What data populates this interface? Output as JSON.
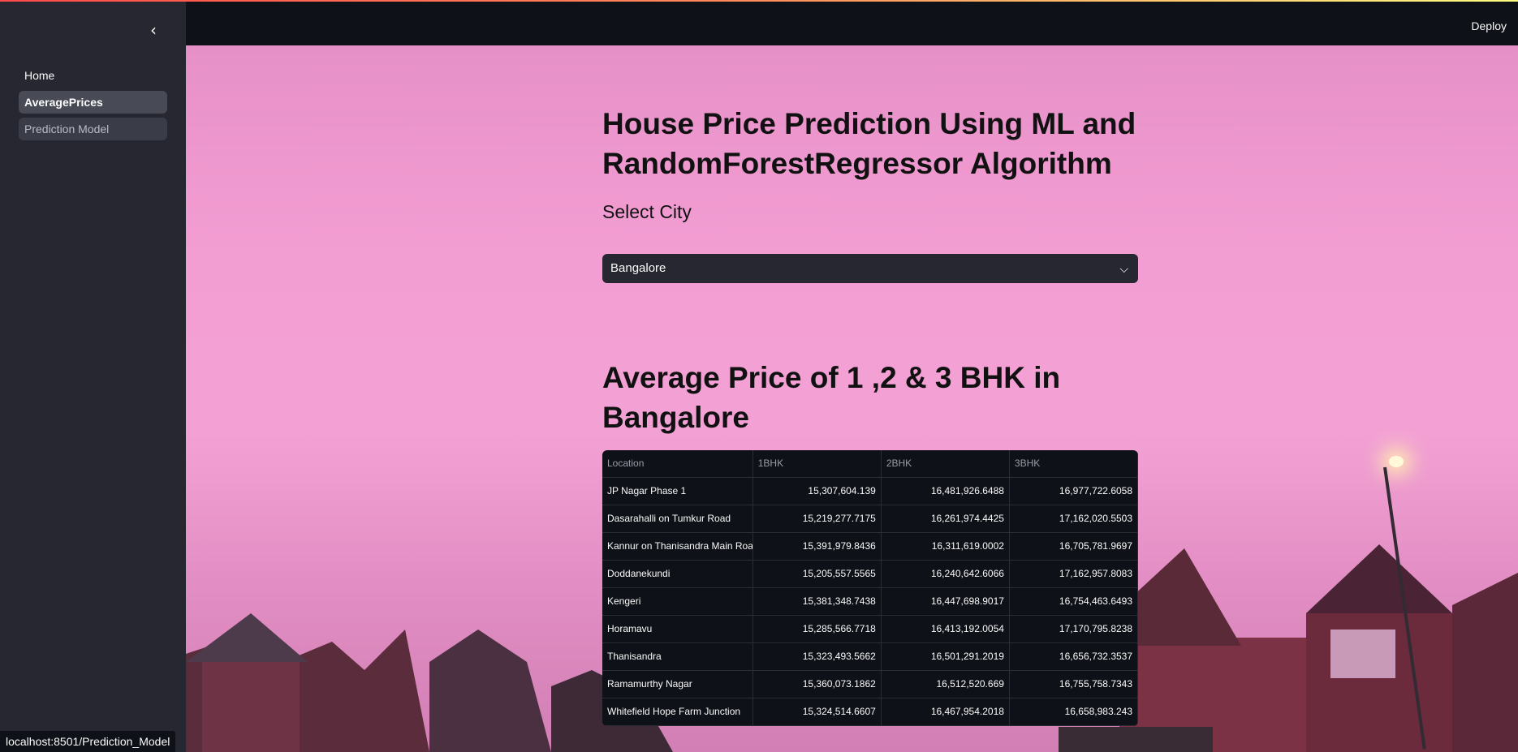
{
  "sidebar": {
    "collapse_icon": "chevron-left-icon",
    "items": [
      {
        "label": "Home",
        "state": "normal"
      },
      {
        "label": "AveragePrices",
        "state": "active"
      },
      {
        "label": "Prediction Model",
        "state": "hover"
      }
    ]
  },
  "header": {
    "deploy_label": "Deploy"
  },
  "main": {
    "title": "House Price Prediction Using ML and RandomForestRegressor Algorithm",
    "subheader": "Select City",
    "city_select": {
      "value": "Bangalore",
      "icon": "chevron-down-icon"
    },
    "section_title": "Average Price of 1 ,2 & 3 BHK in Bangalore",
    "table": {
      "columns": [
        "Location",
        "1BHK",
        "2BHK",
        "3BHK"
      ],
      "rows": [
        [
          "JP Nagar Phase 1",
          "15,307,604.139",
          "16,481,926.6488",
          "16,977,722.6058"
        ],
        [
          "Dasarahalli on Tumkur Road",
          "15,219,277.7175",
          "16,261,974.4425",
          "17,162,020.5503"
        ],
        [
          "Kannur on Thanisandra Main Road",
          "15,391,979.8436",
          "16,311,619.0002",
          "16,705,781.9697"
        ],
        [
          "Doddanekundi",
          "15,205,557.5565",
          "16,240,642.6066",
          "17,162,957.8083"
        ],
        [
          "Kengeri",
          "15,381,348.7438",
          "16,447,698.9017",
          "16,754,463.6493"
        ],
        [
          "Horamavu",
          "15,285,566.7718",
          "16,413,192.0054",
          "17,170,795.8238"
        ],
        [
          "Thanisandra",
          "15,323,493.5662",
          "16,501,291.2019",
          "16,656,732.3537"
        ],
        [
          "Ramamurthy Nagar",
          "15,360,073.1862",
          "16,512,520.669",
          "16,755,758.7343"
        ],
        [
          "Whitefield Hope Farm Junction",
          "15,324,514.6607",
          "16,467,954.2018",
          "16,658,983.243"
        ]
      ]
    }
  },
  "status_bar": {
    "url": "localhost:8501/Prediction_Model"
  },
  "colors": {
    "sidebar_bg": "#262730",
    "app_bg": "#0e1117",
    "accent": "#ff4b4b"
  }
}
